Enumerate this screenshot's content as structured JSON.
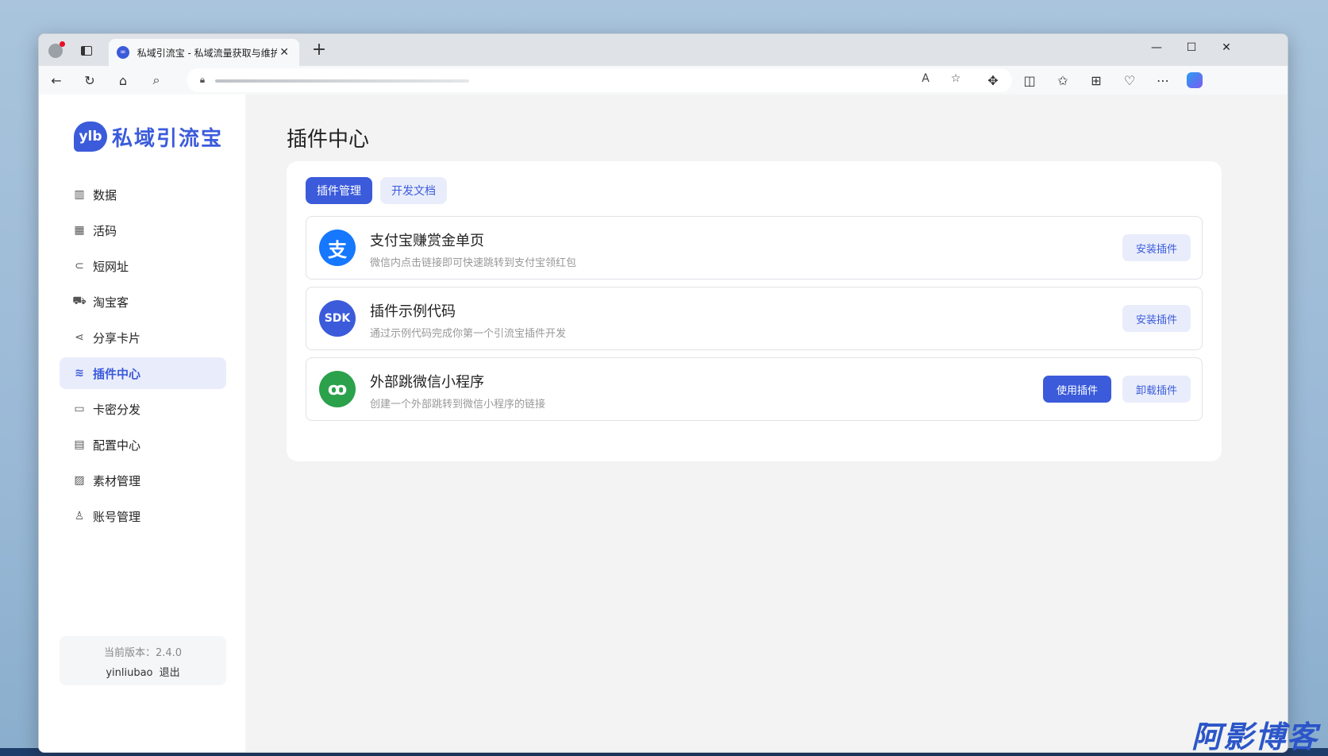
{
  "browser": {
    "tab_title": "私域引流宝 - 私域流量获取与维护",
    "tab_favicon": "∞",
    "close_glyph": "✕",
    "newtab_glyph": "+"
  },
  "window_controls": {
    "minimize": "—",
    "maximize": "☐",
    "close": "✕"
  },
  "app": {
    "logo_mark": "ylb",
    "logo_text": "私域引流宝",
    "page_title": "插件中心"
  },
  "sidebar": {
    "items": [
      {
        "label": "数据",
        "icon": "bar-chart-icon",
        "glyph": "▥",
        "active": false
      },
      {
        "label": "活码",
        "icon": "grid-icon",
        "glyph": "▦",
        "active": false
      },
      {
        "label": "短网址",
        "icon": "link-icon",
        "glyph": "⊂",
        "active": false
      },
      {
        "label": "淘宝客",
        "icon": "cart-icon",
        "glyph": "⛟",
        "active": false
      },
      {
        "label": "分享卡片",
        "icon": "share-icon",
        "glyph": "⋖",
        "active": false
      },
      {
        "label": "插件中心",
        "icon": "layers-icon",
        "glyph": "≋",
        "active": true
      },
      {
        "label": "卡密分发",
        "icon": "card-icon",
        "glyph": "▭",
        "active": false
      },
      {
        "label": "配置中心",
        "icon": "settings-window-icon",
        "glyph": "▤",
        "active": false
      },
      {
        "label": "素材管理",
        "icon": "image-icon",
        "glyph": "▨",
        "active": false
      },
      {
        "label": "账号管理",
        "icon": "user-add-icon",
        "glyph": "♙",
        "active": false
      }
    ],
    "version_text": "当前版本：2.4.0",
    "username": "yinliubao",
    "logout": "退出"
  },
  "tabs": {
    "manage": "插件管理",
    "docs": "开发文档"
  },
  "plugins": [
    {
      "name": "支付宝赚赏金单页",
      "desc": "微信内点击链接即可快速跳转到支付宝领红包",
      "icon_glyph": "支",
      "color": "#1677ff",
      "install": "安装插件"
    },
    {
      "name": "插件示例代码",
      "desc": "通过示例代码完成你第一个引流宝插件开发",
      "icon_glyph": "SDK",
      "color": "#3b5bdb",
      "install": "安装插件"
    },
    {
      "name": "外部跳微信小程序",
      "desc": "创建一个外部跳转到微信小程序的链接",
      "icon_glyph": "ꝏ",
      "color": "#2aa14a",
      "use": "使用插件",
      "uninstall": "卸载插件"
    }
  ],
  "accent_color": "#3b5bdb"
}
